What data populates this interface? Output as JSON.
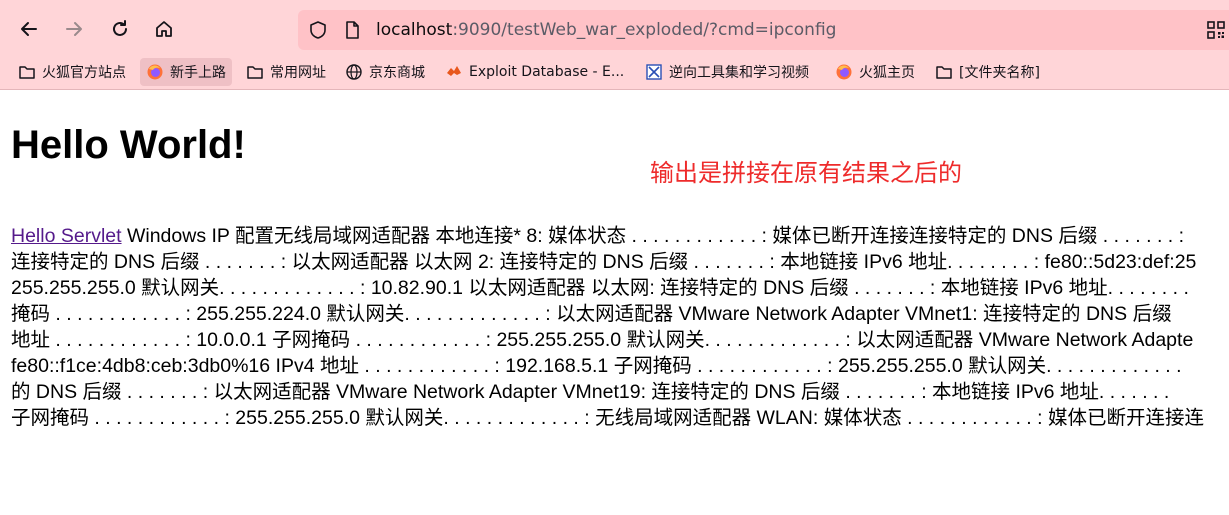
{
  "browser": {
    "url_host": "localhost",
    "url_rest": ":9090/testWeb_war_exploded/?cmd=ipconfig",
    "icons": {
      "back": "back-arrow-icon",
      "forward": "forward-arrow-icon",
      "reload": "reload-icon",
      "home": "home-icon",
      "shield": "shield-icon",
      "page": "page-icon",
      "qr": "qr-code-icon"
    },
    "bookmarks": [
      {
        "label": "火狐官方站点",
        "icon": "folder-icon"
      },
      {
        "label": "新手上路",
        "icon": "firefox-icon"
      },
      {
        "label": "常用网址",
        "icon": "folder-icon"
      },
      {
        "label": "京东商城",
        "icon": "globe-icon"
      },
      {
        "label": "Exploit Database - E...",
        "icon": "exploit-db-icon"
      },
      {
        "label": "逆向工具集和学习视频",
        "icon": "tool-icon"
      },
      {
        "label": "火狐主页",
        "icon": "firefox-icon"
      },
      {
        "label": "[文件夹名称]",
        "icon": "folder-icon"
      }
    ]
  },
  "page": {
    "heading": "Hello World!",
    "annotation": "输出是拼接在原有结果之后的",
    "link_text": "Hello Servlet",
    "lines": [
      " Windows IP 配置无线局域网适配器 本地连接* 8: 媒体状态 . . . . . . . . . . . . : 媒体已断开连接连接特定的 DNS 后缀 . . . . . . . :",
      "连接特定的 DNS 后缀 . . . . . . . : 以太网适配器 以太网 2: 连接特定的 DNS 后缀 . . . . . . . : 本地链接 IPv6 地址. . . . . . . . : fe80::5d23:def:25",
      "255.255.255.0 默认网关. . . . . . . . . . . . . : 10.82.90.1 以太网适配器 以太网: 连接特定的 DNS 后缀 . . . . . . . : 本地链接 IPv6 地址. . . . . . . .",
      "掩码 . . . . . . . . . . . . : 255.255.224.0 默认网关. . . . . . . . . . . . . : 以太网适配器 VMware Network Adapter VMnet1: 连接特定的 DNS 后缀",
      "地址 . . . . . . . . . . . . : 10.0.0.1 子网掩码 . . . . . . . . . . . . : 255.255.255.0 默认网关. . . . . . . . . . . . . : 以太网适配器 VMware Network Adapte",
      "fe80::f1ce:4db8:ceb:3db0%16 IPv4 地址 . . . . . . . . . . . . : 192.168.5.1 子网掩码 . . . . . . . . . . . . : 255.255.255.0 默认网关. . . . . . . . . . . . .",
      "的 DNS 后缀 . . . . . . . : 以太网适配器 VMware Network Adapter VMnet19: 连接特定的 DNS 后缀 . . . . . . . : 本地链接 IPv6 地址. . . . . . .",
      "子网掩码 . . . . . . . . . . . . : 255.255.255.0 默认网关. . . . . . . . . . . . . : 无线局域网适配器 WLAN: 媒体状态 . . . . . . . . . . . . : 媒体已断开连接连"
    ],
    "colors": {
      "annotation": "#ee2b2b",
      "link": "#551a8b",
      "chrome": "#ffd5d8",
      "urlbar": "#ffc2c7"
    }
  }
}
